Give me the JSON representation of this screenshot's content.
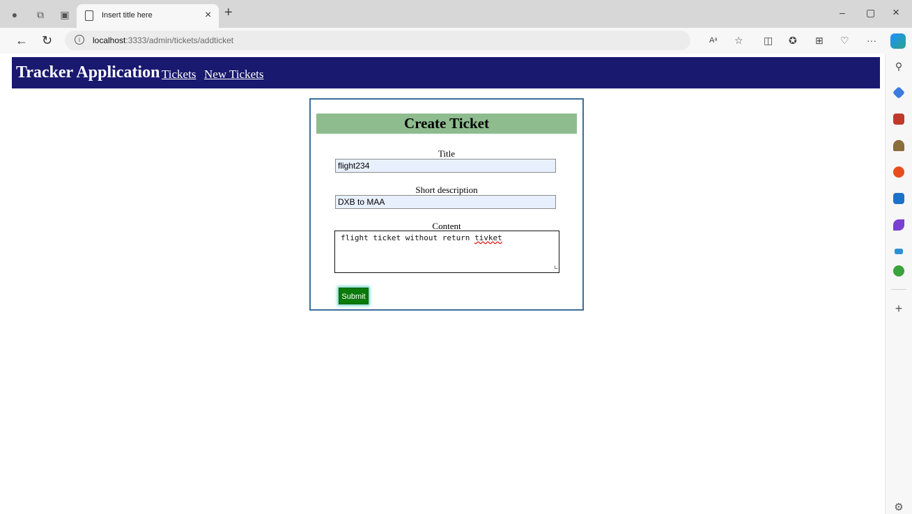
{
  "browser": {
    "tab_title": "Insert title here",
    "tab_close": "×",
    "new_tab": "+",
    "url_host": "localhost",
    "url_rest": ":3333/admin/tickets/addticket",
    "read_aloud": "Aᵃ",
    "more_menu": "···",
    "minimize": "–",
    "restore": "▢",
    "close": "×"
  },
  "app": {
    "brand": "Tracker Application",
    "nav": [
      {
        "label": "Tickets"
      },
      {
        "label": "New Tickets"
      }
    ]
  },
  "form": {
    "heading": "Create Ticket",
    "title_label": "Title",
    "title_value": "flight234",
    "short_label": "Short description",
    "short_value": "DXB to MAA",
    "content_label": "Content",
    "content_value_prefix": "flight ticket without return ",
    "content_value_misspelled": "tivket",
    "submit_label": "Submit"
  },
  "colors": {
    "header_bg": "#191970",
    "card_head_bg": "#8fbc8f",
    "submit_bg": "#0a7a0a",
    "input_bg": "#e8f0fe"
  },
  "icons": [
    "profile-icon",
    "workspaces-icon",
    "tab-actions-icon",
    "page-icon",
    "back-icon",
    "refresh-icon",
    "site-info-icon",
    "favorites-star-icon",
    "split-screen-icon",
    "favorites-bar-icon",
    "collections-icon",
    "performance-icon",
    "copilot-icon",
    "search-icon",
    "shopping-icon",
    "tools-icon",
    "games-icon",
    "office-icon",
    "outlook-icon",
    "designer-icon",
    "drop-icon",
    "tree-icon",
    "add-icon",
    "settings-icon"
  ]
}
